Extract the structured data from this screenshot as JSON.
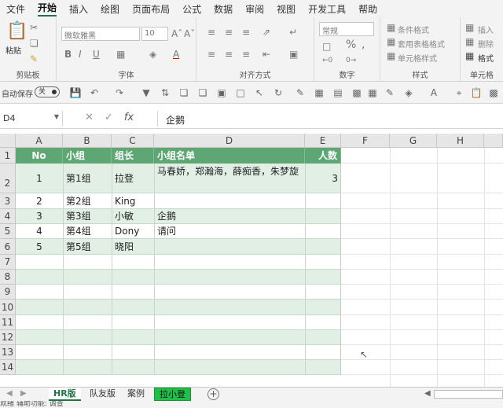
{
  "menu": {
    "items": [
      "文件",
      "开始",
      "插入",
      "绘图",
      "页面布局",
      "公式",
      "数据",
      "审阅",
      "视图",
      "开发工具",
      "帮助"
    ],
    "active": "开始"
  },
  "ribbon": {
    "clipboard": {
      "label": "剪贴板",
      "paste": "粘贴"
    },
    "font": {
      "label": "字体",
      "font_name": "微软雅黑",
      "font_size": "10",
      "bold": "B",
      "italic": "I",
      "underline": "U"
    },
    "alignment": {
      "label": "对齐方式"
    },
    "number": {
      "label": "数字",
      "format": "常规"
    },
    "styles": {
      "label": "样式",
      "conditional": "条件格式",
      "table": "套用表格格式",
      "cell": "单元格样式"
    },
    "cells": {
      "label": "单元格",
      "insert": "插入",
      "delete": "删除",
      "format": "格式"
    }
  },
  "qat": {
    "autosave": "自动保存",
    "toggle": "关"
  },
  "formula_bar": {
    "name_box": "D4",
    "content": "企鹅",
    "fx": "fx"
  },
  "columns": [
    "A",
    "B",
    "C",
    "D",
    "E",
    "F",
    "G",
    "H"
  ],
  "rows": [
    "1",
    "2",
    "3",
    "4",
    "5",
    "6",
    "7",
    "8",
    "9",
    "10",
    "11",
    "12",
    "13",
    "14"
  ],
  "table": {
    "headers": [
      "No",
      "小组",
      "组长",
      "小组名单",
      "人数"
    ],
    "data": [
      [
        "1",
        "第1组",
        "拉登",
        "马春娇，郑瀚海，薛痴香，朱梦旋",
        "3"
      ],
      [
        "2",
        "第2组",
        "King",
        "",
        ""
      ],
      [
        "3",
        "第3组",
        "小敏",
        "企鹅",
        ""
      ],
      [
        "4",
        "第4组",
        "Dony",
        "请问",
        ""
      ],
      [
        "5",
        "第5组",
        "晓阳",
        "",
        ""
      ]
    ]
  },
  "sheets": {
    "tabs": [
      "HR版",
      "队友版",
      "案例",
      "拉小登"
    ],
    "active": "HR版",
    "green": "拉小登",
    "add": "+"
  },
  "status": {
    "text": "就绪    辅助功能: 调查"
  }
}
